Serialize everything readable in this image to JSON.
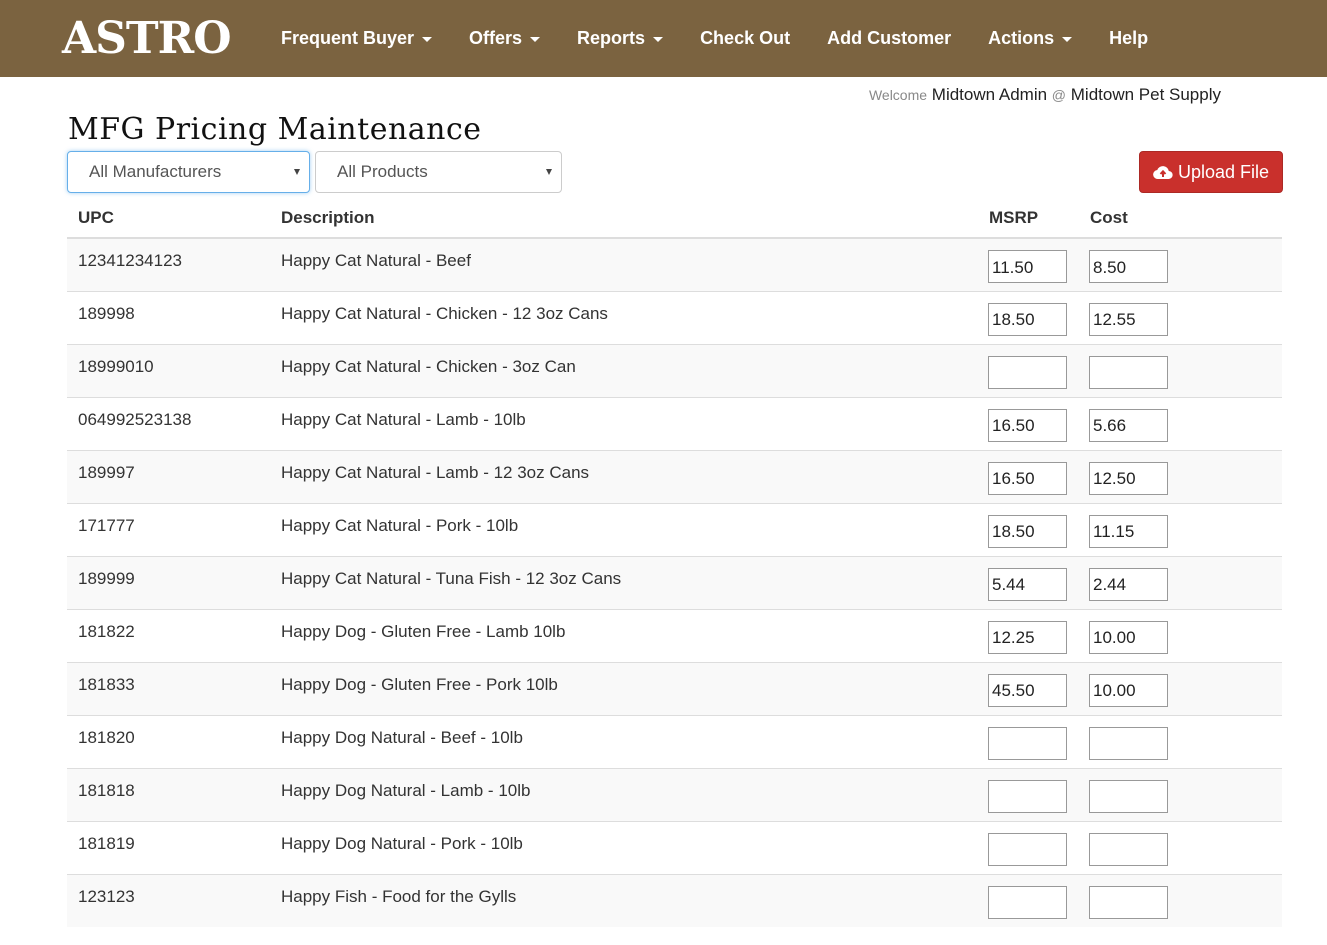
{
  "nav": {
    "logo": "ASTRO",
    "items": [
      {
        "label": "Frequent Buyer",
        "dropdown": true
      },
      {
        "label": "Offers",
        "dropdown": true
      },
      {
        "label": "Reports",
        "dropdown": true
      },
      {
        "label": "Check Out",
        "dropdown": false
      },
      {
        "label": "Add Customer",
        "dropdown": false
      },
      {
        "label": "Actions",
        "dropdown": true
      },
      {
        "label": "Help",
        "dropdown": false
      }
    ]
  },
  "welcome": {
    "prefix": "Welcome",
    "user": "Midtown Admin",
    "at": "@",
    "store": "Midtown Pet Supply"
  },
  "page": {
    "title": "MFG Pricing Maintenance"
  },
  "filters": {
    "manufacturer": "All Manufacturers",
    "product": "All Products"
  },
  "upload": {
    "label": "Upload File",
    "icon": "cloud-upload-icon"
  },
  "colors": {
    "navbar": "#7b6340",
    "upload_button": "#c9302c"
  },
  "table": {
    "headers": {
      "upc": "UPC",
      "description": "Description",
      "msrp": "MSRP",
      "cost": "Cost"
    },
    "rows": [
      {
        "upc": "12341234123",
        "description": "Happy Cat Natural - Beef",
        "msrp": "11.50",
        "cost": "8.50"
      },
      {
        "upc": "189998",
        "description": "Happy Cat Natural - Chicken - 12 3oz Cans",
        "msrp": "18.50",
        "cost": "12.55"
      },
      {
        "upc": "18999010",
        "description": "Happy Cat Natural - Chicken - 3oz Can",
        "msrp": "",
        "cost": ""
      },
      {
        "upc": "064992523138",
        "description": "Happy Cat Natural - Lamb - 10lb",
        "msrp": "16.50",
        "cost": "5.66"
      },
      {
        "upc": "189997",
        "description": "Happy Cat Natural - Lamb - 12 3oz Cans",
        "msrp": "16.50",
        "cost": "12.50"
      },
      {
        "upc": "171777",
        "description": "Happy Cat Natural - Pork - 10lb",
        "msrp": "18.50",
        "cost": "11.15"
      },
      {
        "upc": "189999",
        "description": "Happy Cat Natural - Tuna Fish - 12 3oz Cans",
        "msrp": "5.44",
        "cost": "2.44"
      },
      {
        "upc": "181822",
        "description": "Happy Dog - Gluten Free - Lamb 10lb",
        "msrp": "12.25",
        "cost": "10.00"
      },
      {
        "upc": "181833",
        "description": "Happy Dog - Gluten Free - Pork 10lb",
        "msrp": "45.50",
        "cost": "10.00"
      },
      {
        "upc": "181820",
        "description": "Happy Dog Natural - Beef - 10lb",
        "msrp": "",
        "cost": ""
      },
      {
        "upc": "181818",
        "description": "Happy Dog Natural - Lamb - 10lb",
        "msrp": "",
        "cost": ""
      },
      {
        "upc": "181819",
        "description": "Happy Dog Natural - Pork - 10lb",
        "msrp": "",
        "cost": ""
      },
      {
        "upc": "123123",
        "description": "Happy Fish - Food for the Gylls",
        "msrp": "",
        "cost": ""
      }
    ]
  }
}
